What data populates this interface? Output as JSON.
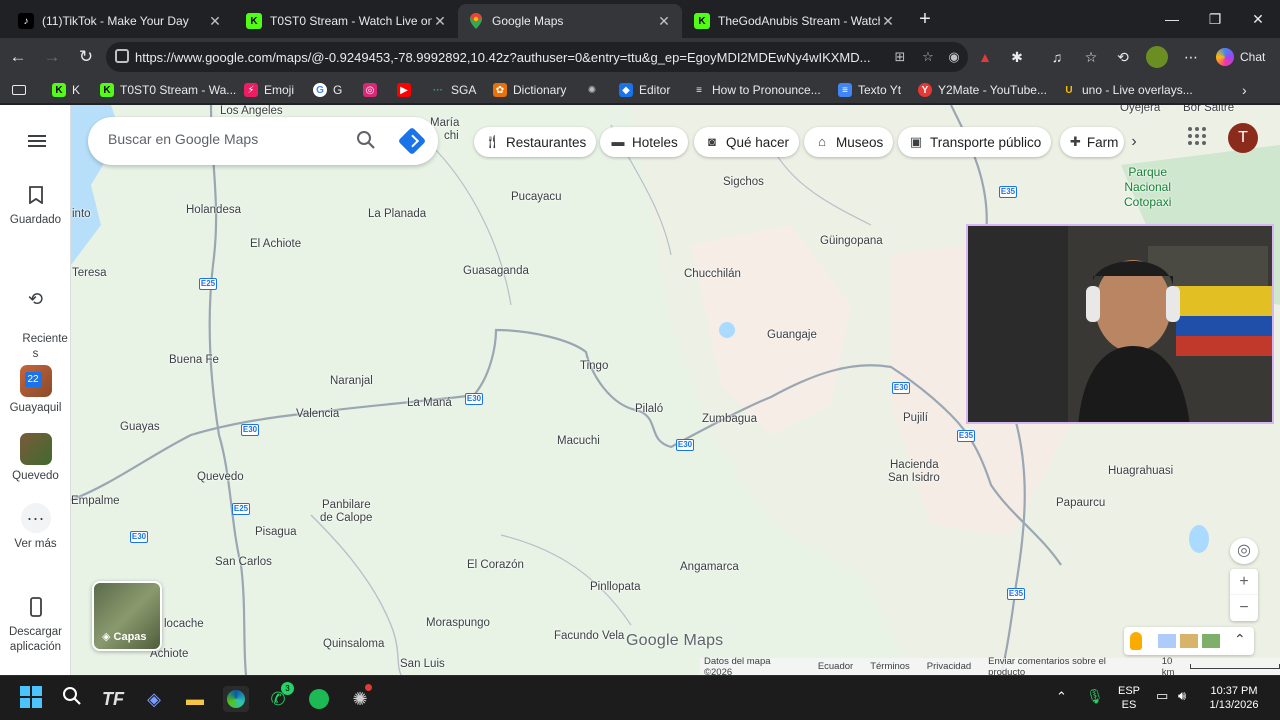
{
  "browser": {
    "tabs": [
      {
        "title": "(11)TikTok - Make Your Day",
        "active": false
      },
      {
        "title": "T0ST0 Stream - Watch Live on Kick",
        "active": false
      },
      {
        "title": "Google Maps",
        "active": true
      },
      {
        "title": "TheGodAnubis Stream - Watch Live",
        "active": false
      }
    ],
    "url": "https://www.google.com/maps/@-0.9249453,-78.9992892,10.42z?authuser=0&entry=ttu&g_ep=EgoyMDI2MDEwNy4wIKXMD...",
    "chat_label": "Chat",
    "bookmarks": [
      {
        "label": "K",
        "icon": "kick-icon",
        "color": "#53fc18"
      },
      {
        "label": "T0ST0 Stream - Wa...",
        "icon": "kick-icon",
        "color": "#53fc18"
      },
      {
        "label": "Emoji",
        "icon": "emoji-icon",
        "color": "#e91e63"
      },
      {
        "label": "G",
        "icon": "google-icon",
        "color": "#4285f4"
      },
      {
        "label": "",
        "icon": "instagram-icon",
        "color": "#d62976"
      },
      {
        "label": "",
        "icon": "youtube-icon",
        "color": "#ff0000"
      },
      {
        "label": "SGA",
        "icon": "sga-icon",
        "color": "#34a853"
      },
      {
        "label": "Dictionary",
        "icon": "dictionary-icon",
        "color": "#e8710a"
      },
      {
        "label": "",
        "icon": "openai-icon",
        "color": "#9aa0a6"
      },
      {
        "label": "Editor",
        "icon": "editor-icon",
        "color": "#1a73e8"
      },
      {
        "label": "How to Pronounce...",
        "icon": "pronounce-icon",
        "color": "#e8eaed"
      },
      {
        "label": "Texto Yt",
        "icon": "doc-icon",
        "color": "#4285f4"
      },
      {
        "label": "Y2Mate - YouTube...",
        "icon": "y2mate-icon",
        "color": "#e53935"
      },
      {
        "label": "uno - Live overlays...",
        "icon": "uno-icon",
        "color": "#fbbc04"
      }
    ]
  },
  "maps": {
    "search_placeholder": "Buscar en Google Maps",
    "chips": [
      {
        "label": "Restaurantes",
        "icon": "restaurant-icon"
      },
      {
        "label": "Hoteles",
        "icon": "hotel-icon"
      },
      {
        "label": "Qué hacer",
        "icon": "camera-icon"
      },
      {
        "label": "Museos",
        "icon": "museum-icon"
      },
      {
        "label": "Transporte público",
        "icon": "transit-icon"
      },
      {
        "label": "Farm",
        "icon": "pharmacy-icon"
      }
    ],
    "avatar_initial": "T",
    "sidebar": {
      "saved": "Guardado",
      "recents": "Reciente\ns",
      "recent_place_1": "Guayaquil",
      "recent_place_1_badge": "22",
      "recent_place_2": "Quevedo",
      "more": "Ver más",
      "download": "Descargar aplicación"
    },
    "layers_label": "Capas",
    "logo": "Google Maps",
    "footer": [
      "Datos del mapa ©2026",
      "Ecuador",
      "Términos",
      "Privacidad",
      "Enviar comentarios sobre el producto"
    ],
    "scale": "10 km",
    "places": [
      "Los Angeles",
      "María",
      "chi",
      "Pucayacu",
      "Sigchos",
      "Holandesa",
      "La Planada",
      "El Achiote",
      "into",
      "Guasaganda",
      "Chucchilán",
      "Güingopana",
      "Teresa",
      "Guangaje",
      "Tingo",
      "Buena Fe",
      "Naranjal",
      "La Maná",
      "Valencia",
      "Pilaló",
      "Zumbagua",
      "Pujilí",
      "Guayas",
      "Macuchi",
      "Quevedo",
      "Hacienda",
      "San Isidro",
      "Huagrahuasi",
      "Empalme",
      "Panbilare",
      "de Calope",
      "Papaurcu",
      "Pisagua",
      "San Carlos",
      "El Corazón",
      "Angamarca",
      "Pinllopata",
      "locache",
      "Quinsaloma",
      "Moraspungo",
      "Facundo Vela",
      "Achiote",
      "San Luis",
      "Oyejera",
      "Bor Saltre"
    ],
    "park": "Parque\nNacional\nCotopaxi",
    "highways": [
      "E35",
      "E25",
      "E30",
      "E30",
      "E30",
      "E30",
      "E25",
      "E30",
      "E35",
      "E35",
      "E35"
    ]
  },
  "taskbar": {
    "lang": "ESP",
    "lang2": "ES",
    "time": "10:37 PM",
    "date": "1/13/2026",
    "whatsapp_badge": "3"
  }
}
